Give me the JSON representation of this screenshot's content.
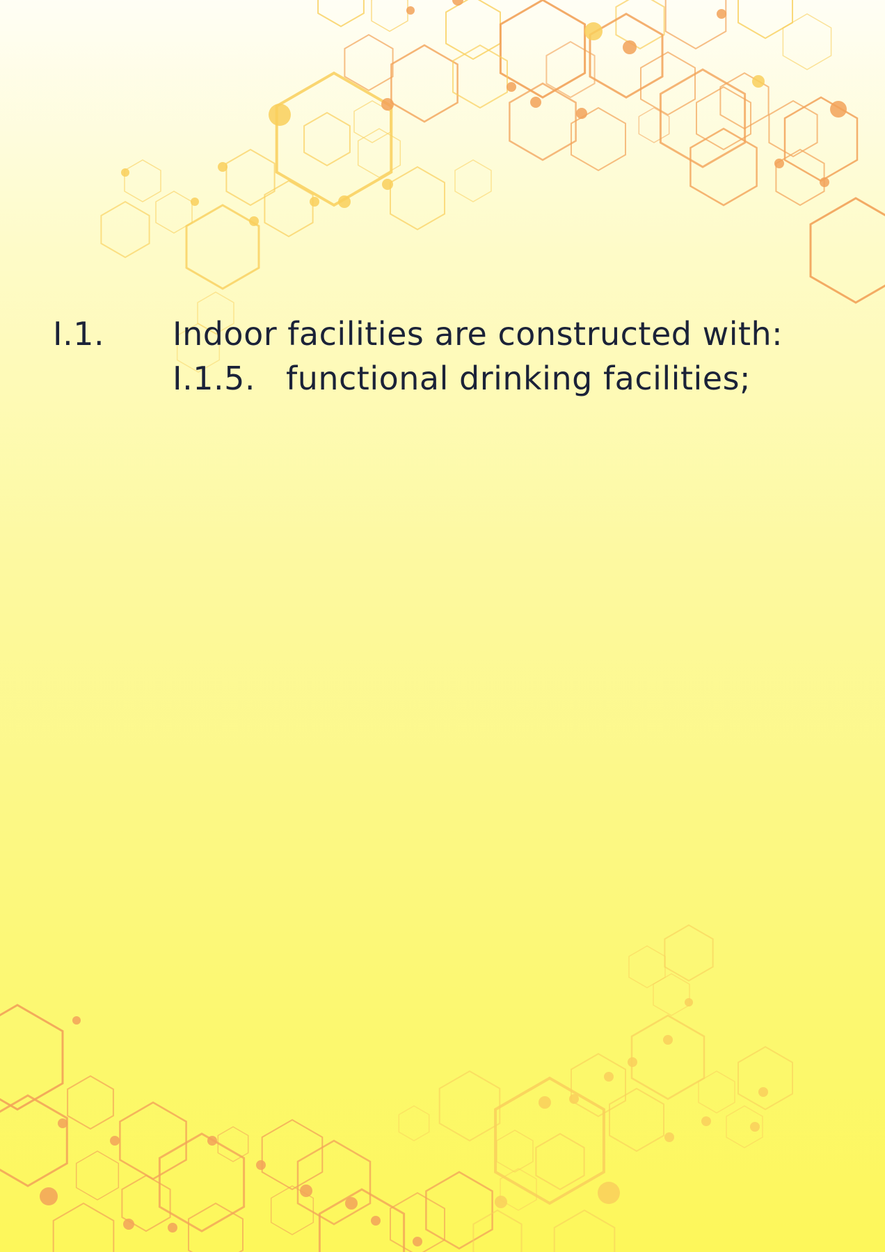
{
  "colors": {
    "text": "#1b2238",
    "hex_orange": "#f2a259",
    "hex_gold": "#f9cf5c",
    "dot_orange": "#f3a05b"
  },
  "decoration": "hexagon-molecule-pattern",
  "items": [
    {
      "number": "I.1.",
      "text": "Indoor facilities are constructed with:"
    },
    {
      "number": "I.1.5.",
      "text": "functional drinking facilities;"
    }
  ]
}
